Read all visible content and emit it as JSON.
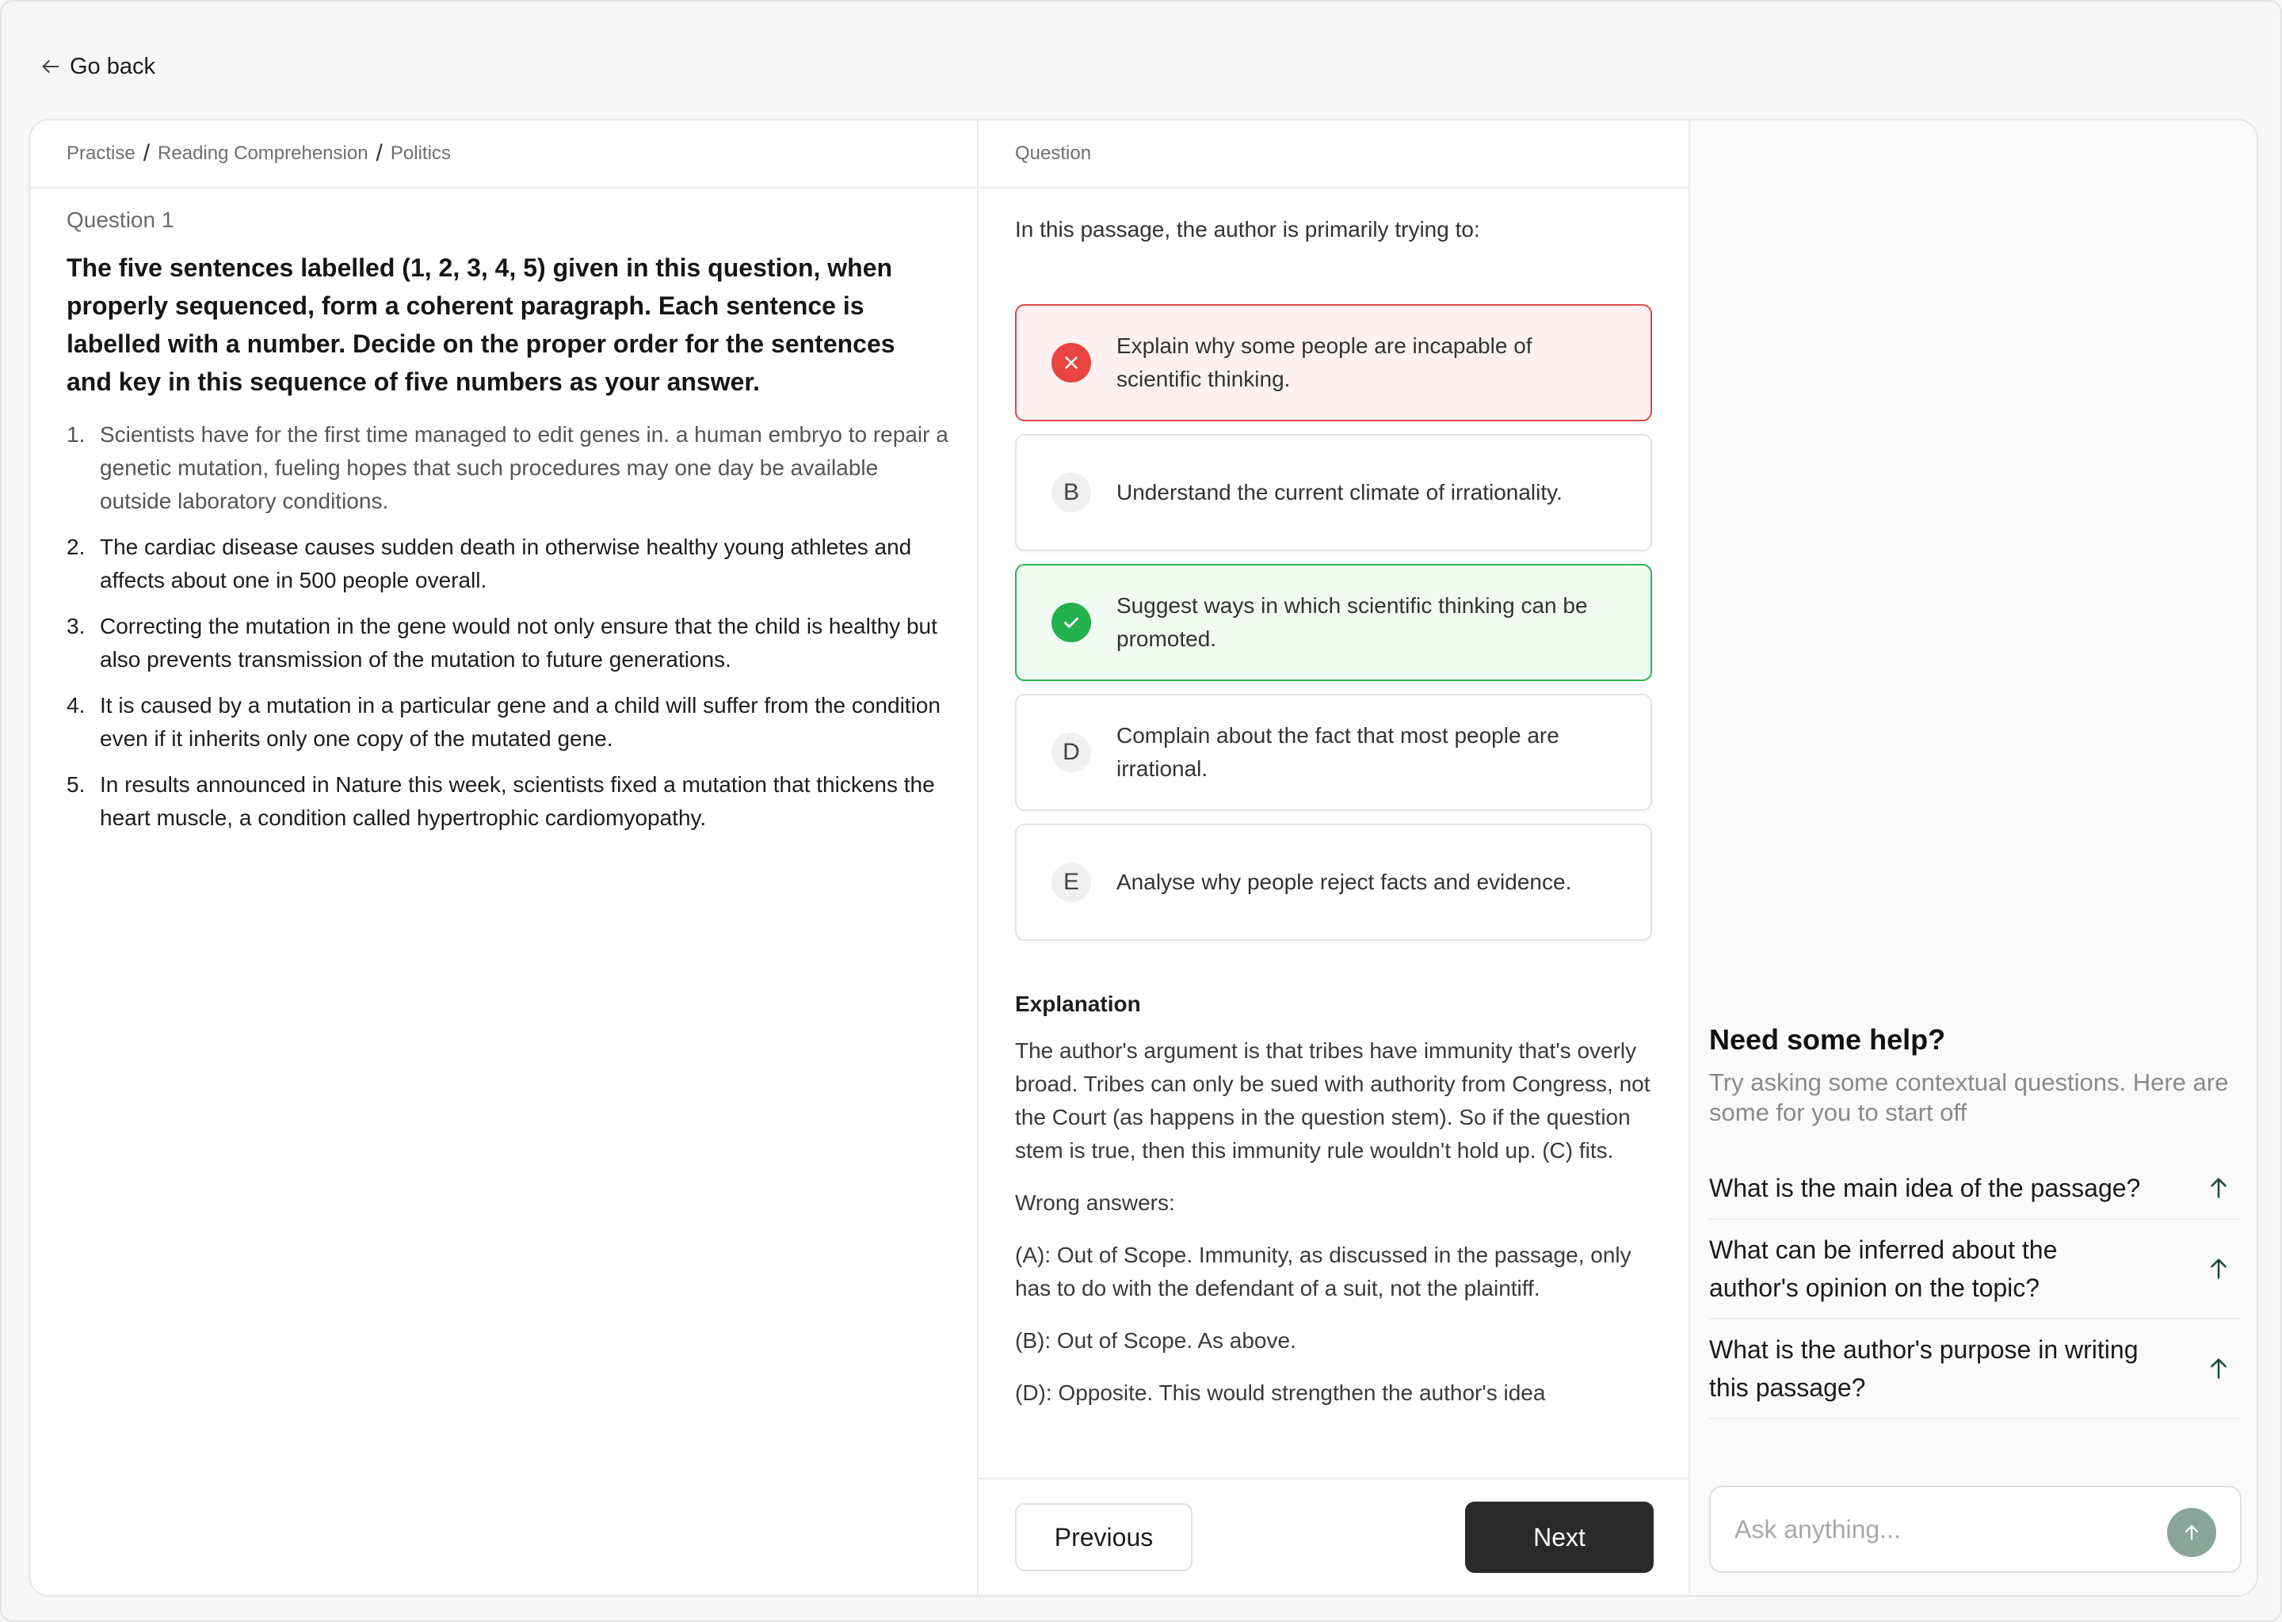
{
  "nav": {
    "go_back": "Go back"
  },
  "breadcrumb": [
    "Practise",
    "Reading Comprehension",
    "Politics"
  ],
  "left": {
    "question_number": "Question 1",
    "question_title": "The five sentences labelled (1, 2, 3, 4, 5) given in this question, when properly sequenced, form a coherent paragraph. Each sentence is labelled with a number. Decide on the proper order for the sentences and key in this sequence of five numbers as your answer.",
    "sentences": [
      {
        "num": "1.",
        "text": "Scientists have for the first time managed to edit genes in. a human embryo to repair a genetic mutation, fueling hopes that such procedures may one day be available outside laboratory conditions."
      },
      {
        "num": "2.",
        "text": "The cardiac disease causes sudden death in otherwise healthy young athletes and affects about one in 500 people overall."
      },
      {
        "num": "3.",
        "text": "Correcting the mutation in the gene would not only ensure that the child is healthy but also prevents transmission of the mutation to future generations."
      },
      {
        "num": "4.",
        "text": "It is caused by a mutation in a particular gene and a child will suffer from the condition even if it inherits only one copy of the mutated gene."
      },
      {
        "num": "5.",
        "text": "In results announced in Nature this week, scientists fixed a mutation that thickens the heart muscle, a condition called hypertrophic cardiomyopathy."
      }
    ]
  },
  "middle": {
    "header": "Question",
    "prompt": "In this passage, the author is primarily trying to:",
    "options": [
      {
        "letter": "A",
        "status": "wrong",
        "text": "Explain why some people are incapable of scientific thinking."
      },
      {
        "letter": "B",
        "status": "neutral",
        "text": "Understand the current climate of irrationality."
      },
      {
        "letter": "C",
        "status": "correct",
        "text": "Suggest ways in which scientific thinking can be promoted."
      },
      {
        "letter": "D",
        "status": "neutral",
        "text": "Complain about the fact that most people are irrational."
      },
      {
        "letter": "E",
        "status": "neutral",
        "text": "Analyse why people reject facts and evidence."
      }
    ],
    "explanation": {
      "title": "Explanation",
      "body": "The author's argument is that tribes have immunity that's overly broad. Tribes can only be sued with authority from Congress, not the Court (as happens in the question stem). So if the question stem is true, then this immunity rule wouldn't hold up. (C) fits.",
      "wrong_heading": "Wrong answers:",
      "wrong_a": "(A): Out of Scope. Immunity, as discussed in the passage, only has to do with the defendant of a suit, not the plaintiff.",
      "wrong_b": "(B): Out of Scope. As above.",
      "wrong_d": "(D): Opposite. This would strengthen the author's idea"
    },
    "buttons": {
      "previous": "Previous",
      "next": "Next"
    }
  },
  "right": {
    "help_title": "Need some help?",
    "help_subtitle": "Try asking some contextual questions. Here are some for you to start off",
    "suggestions": [
      "What is the main idea of the passage?",
      "What can be inferred about the author's opinion on the topic?",
      "What is the author's purpose in writing this passage?"
    ],
    "ask_placeholder": "Ask anything..."
  },
  "colors": {
    "wrong": "#e9443f",
    "correct": "#23b14d",
    "primary_button": "#2a2a2a",
    "send_button": "#8aa59a"
  }
}
